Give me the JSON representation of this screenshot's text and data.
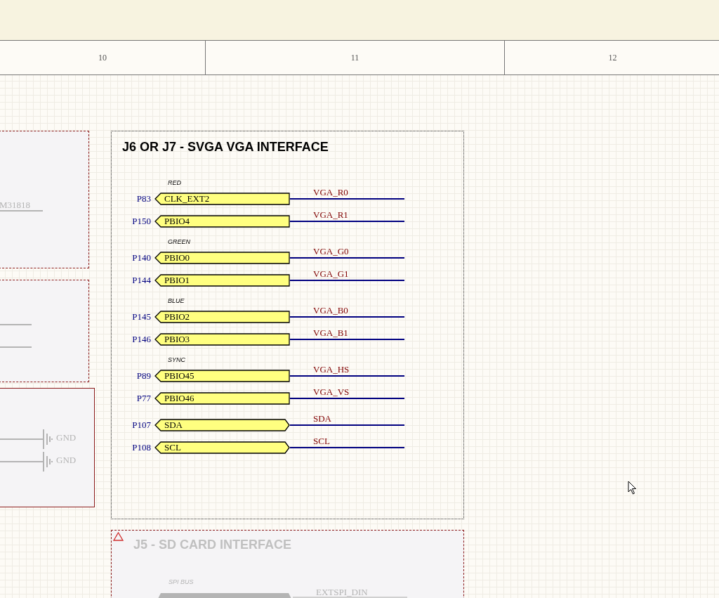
{
  "border_columns": [
    "10",
    "11",
    "12"
  ],
  "offsheet": {
    "part_label": "M31818",
    "gnd_labels": [
      "GND",
      "GND"
    ]
  },
  "vga_sheet": {
    "title": "J6 OR J7 - SVGA VGA INTERFACE",
    "groups": [
      {
        "label": "RED",
        "ports": [
          {
            "pin": "P83",
            "name": "CLK_EXT2",
            "net": "VGA_R0",
            "kind": "input"
          },
          {
            "pin": "P150",
            "name": "PBIO4",
            "net": "VGA_R1",
            "kind": "input"
          }
        ]
      },
      {
        "label": "GREEN",
        "ports": [
          {
            "pin": "P140",
            "name": "PBIO0",
            "net": "VGA_G0",
            "kind": "input"
          },
          {
            "pin": "P144",
            "name": "PBIO1",
            "net": "VGA_G1",
            "kind": "input"
          }
        ]
      },
      {
        "label": "BLUE",
        "ports": [
          {
            "pin": "P145",
            "name": "PBIO2",
            "net": "VGA_B0",
            "kind": "input"
          },
          {
            "pin": "P146",
            "name": "PBIO3",
            "net": "VGA_B1",
            "kind": "input"
          }
        ]
      },
      {
        "label": "SYNC",
        "ports": [
          {
            "pin": "P89",
            "name": "PBIO45",
            "net": "VGA_HS",
            "kind": "input"
          },
          {
            "pin": "P77",
            "name": "PBIO46",
            "net": "VGA_VS",
            "kind": "input"
          }
        ]
      },
      {
        "ports": [
          {
            "pin": "P107",
            "name": "SDA",
            "net": "SDA",
            "kind": "bidirectional"
          },
          {
            "pin": "P108",
            "name": "SCL",
            "net": "SCL",
            "kind": "bidirectional"
          }
        ]
      }
    ]
  },
  "sd_sheet": {
    "title": "J5 - SD CARD INTERFACE",
    "group_label": "SPI BUS",
    "net": "EXTSPI_DIN"
  }
}
